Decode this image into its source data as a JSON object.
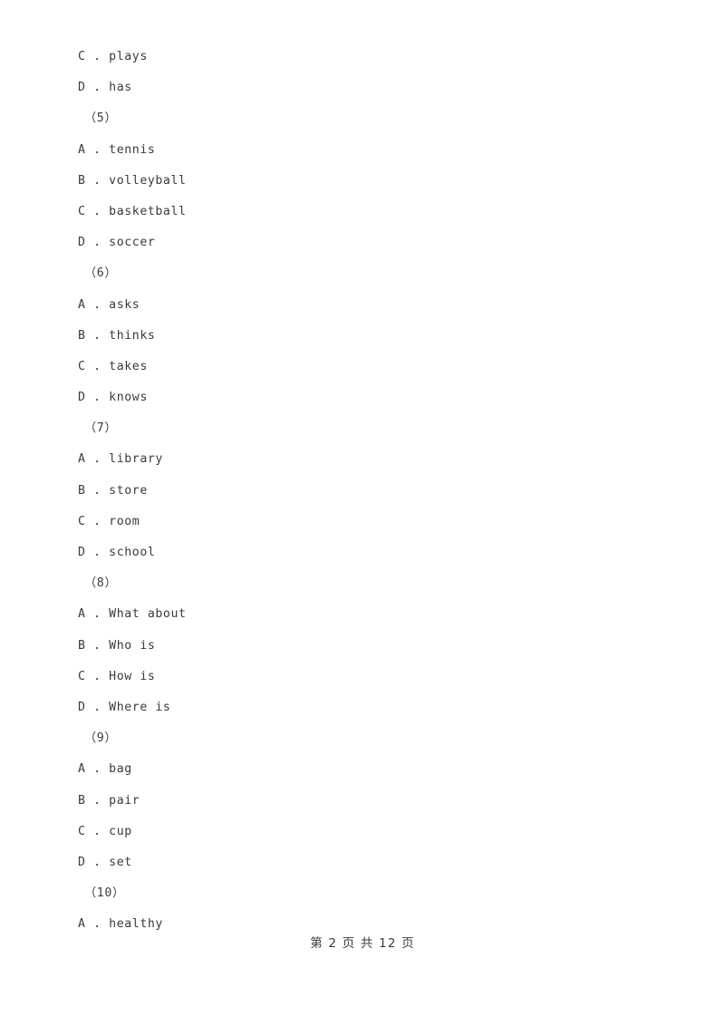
{
  "document": {
    "page_label": "第 2 页 共 12 页",
    "page_number": 2,
    "total_pages": 12,
    "text_color": "#3b3b3b",
    "background_color": "#ffffff"
  },
  "body": {
    "lines": [
      {
        "type": "option",
        "text": "C . plays"
      },
      {
        "type": "option",
        "text": "D . has"
      },
      {
        "type": "qnum",
        "text": "（5）"
      },
      {
        "type": "option",
        "text": "A . tennis"
      },
      {
        "type": "option",
        "text": "B . volleyball"
      },
      {
        "type": "option",
        "text": "C . basketball"
      },
      {
        "type": "option",
        "text": "D . soccer"
      },
      {
        "type": "qnum",
        "text": "（6）"
      },
      {
        "type": "option",
        "text": "A . asks"
      },
      {
        "type": "option",
        "text": "B . thinks"
      },
      {
        "type": "option",
        "text": "C . takes"
      },
      {
        "type": "option",
        "text": "D . knows"
      },
      {
        "type": "qnum",
        "text": "（7）"
      },
      {
        "type": "option",
        "text": "A . library"
      },
      {
        "type": "option",
        "text": "B . store"
      },
      {
        "type": "option",
        "text": "C . room"
      },
      {
        "type": "option",
        "text": "D . school"
      },
      {
        "type": "qnum",
        "text": "（8）"
      },
      {
        "type": "option",
        "text": "A . What about"
      },
      {
        "type": "option",
        "text": "B . Who is"
      },
      {
        "type": "option",
        "text": "C . How is"
      },
      {
        "type": "option",
        "text": "D . Where is"
      },
      {
        "type": "qnum",
        "text": "（9）"
      },
      {
        "type": "option",
        "text": "A . bag"
      },
      {
        "type": "option",
        "text": "B . pair"
      },
      {
        "type": "option",
        "text": "C . cup"
      },
      {
        "type": "option",
        "text": "D . set"
      },
      {
        "type": "qnum",
        "text": "（10）"
      },
      {
        "type": "option",
        "text": "A . healthy"
      }
    ]
  }
}
